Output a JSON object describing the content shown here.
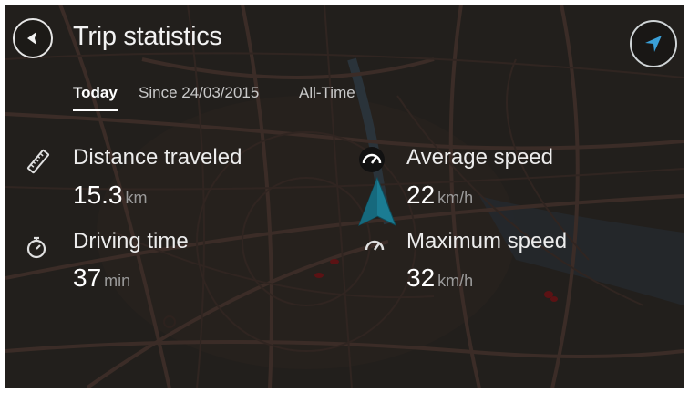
{
  "header": {
    "title": "Trip statistics",
    "back_icon": "back-arrow-icon",
    "nav_icon": "navigation-arrow-icon"
  },
  "tabs": [
    {
      "label": "Today",
      "active": true
    },
    {
      "label": "Since 24/03/2015",
      "active": false
    },
    {
      "label": "All-Time",
      "active": false
    }
  ],
  "stats": {
    "distance": {
      "label": "Distance traveled",
      "value": "15.3",
      "unit": "km",
      "icon": "ruler-icon"
    },
    "driving_time": {
      "label": "Driving time",
      "value": "37",
      "unit": "min",
      "icon": "stopwatch-icon"
    },
    "average_speed": {
      "label": "Average speed",
      "value": "22",
      "unit": "km/h",
      "icon": "speedometer-icon"
    },
    "maximum_speed": {
      "label": "Maximum speed",
      "value": "32",
      "unit": "km/h",
      "icon": "speedometer-icon"
    }
  },
  "colors": {
    "background_map": "#2a2622",
    "road": "#4a3a33",
    "accent_marker": "#1b7c93",
    "nav_arrow": "#3aa0d8",
    "unit_text": "#9a9a9a"
  }
}
